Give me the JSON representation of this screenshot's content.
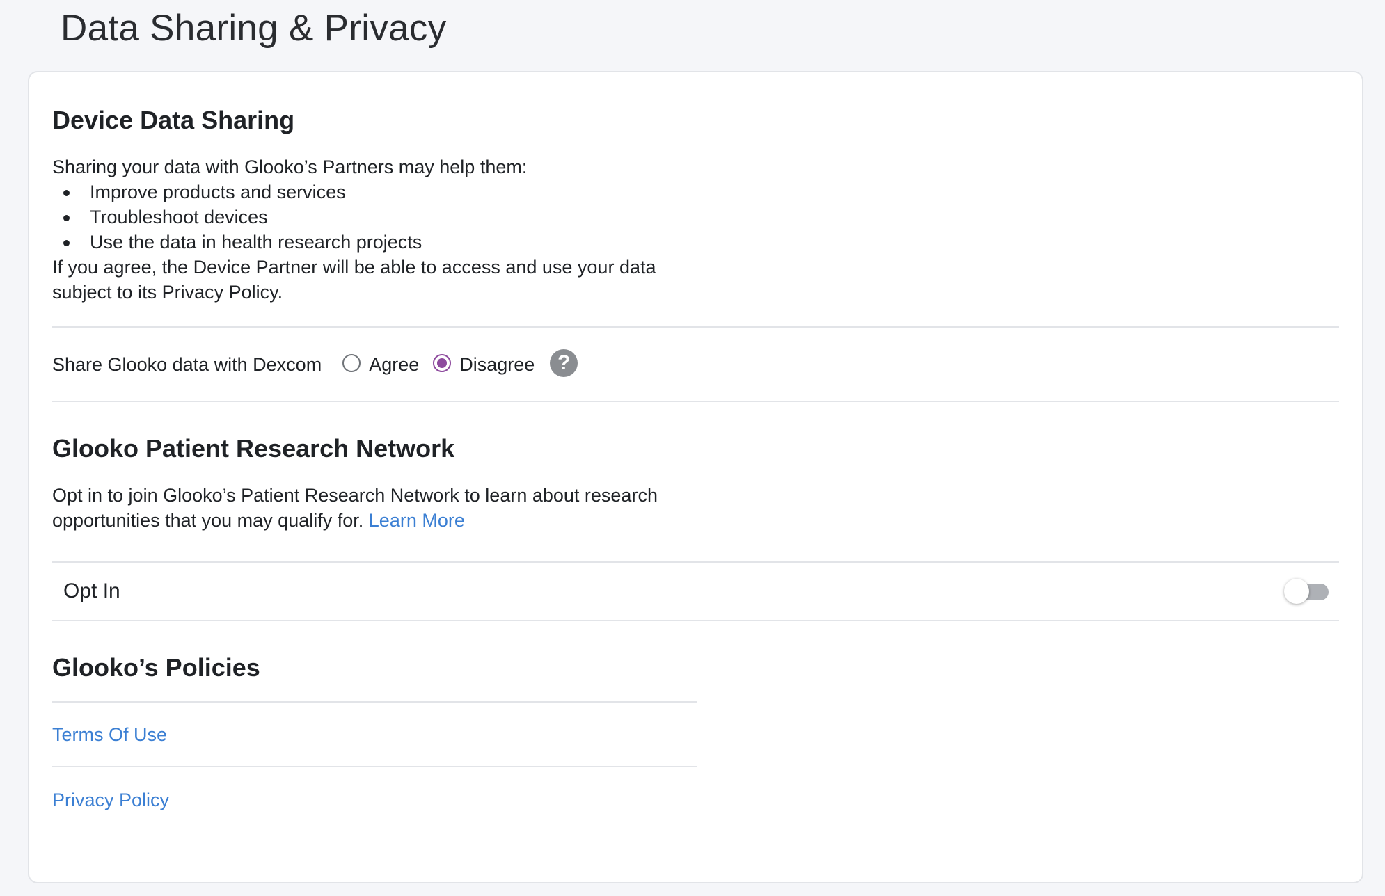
{
  "page": {
    "title": "Data Sharing & Privacy"
  },
  "device_sharing": {
    "heading": "Device Data Sharing",
    "intro": "Sharing your data with Glooko’s Partners may help them:",
    "bullets": [
      "Improve products and services",
      "Troubleshoot devices",
      "Use the data in health research projects"
    ],
    "outro_line1": "If you agree, the Device Partner will be able to access and use your data",
    "outro_line2": "subject to its Privacy Policy.",
    "share_label": "Share Glooko data with Dexcom",
    "options": [
      {
        "label": "Agree",
        "selected": false
      },
      {
        "label": "Disagree",
        "selected": true
      }
    ],
    "help_icon": "question-circle-icon",
    "help_glyph": "?"
  },
  "research_network": {
    "heading": "Glooko Patient Research Network",
    "text_line1": "Opt in to join Glooko’s Patient Research Network to learn about research",
    "text_line2": "opportunities that you may qualify for.",
    "learn_more": "Learn More",
    "optin_label": "Opt In",
    "optin_enabled": false
  },
  "policies": {
    "heading": "Glooko’s Policies",
    "links": [
      "Terms Of Use",
      "Privacy Policy"
    ]
  },
  "colors": {
    "accent": "#8e4b9e",
    "link": "#3b7fd3",
    "background": "#f5f6f9"
  }
}
